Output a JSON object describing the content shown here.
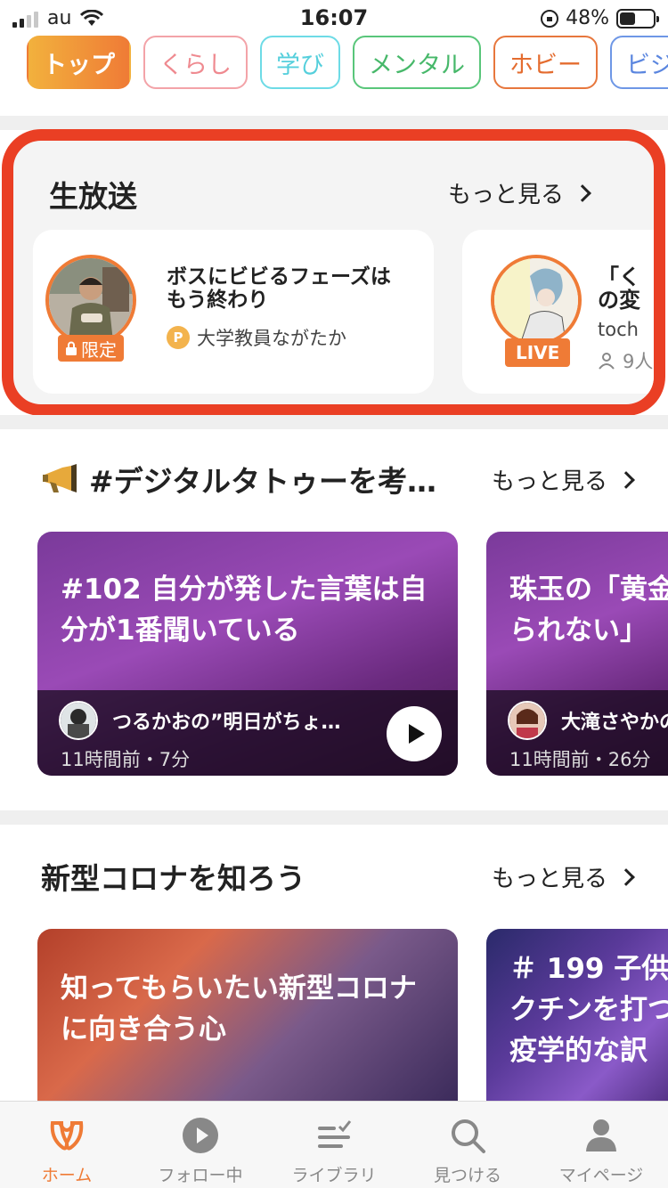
{
  "status_bar": {
    "carrier": "au",
    "time": "16:07",
    "battery_percent": "48%",
    "battery_level": 0.48
  },
  "category_tabs": [
    {
      "label": "トップ",
      "active": true
    },
    {
      "label": "くらし",
      "active": false
    },
    {
      "label": "学び",
      "active": false
    },
    {
      "label": "メンタル",
      "active": false
    },
    {
      "label": "ホビー",
      "active": false
    },
    {
      "label": "ビジ",
      "active": false
    }
  ],
  "live_section": {
    "title": "生放送",
    "more_label": "もっと見る",
    "cards": [
      {
        "title_line1": "ボスにビビるフェーズは",
        "title_line2": "もう終わり",
        "badge": "限定",
        "host": "大学教員ながたか",
        "coin_icon": "P"
      },
      {
        "title_line1": "「く",
        "title_line2": "の変",
        "badge": "LIVE",
        "host": "toch",
        "listeners": "9人"
      }
    ]
  },
  "digital_section": {
    "title": "#デジタルタトゥーを考…",
    "more_label": "もっと見る",
    "cards": [
      {
        "title_line1": "#102 自分が発した言葉は自",
        "title_line2": "分が1番聞いている",
        "author": "つるかおの”明日がちょ…",
        "meta": "11時間前・7分"
      },
      {
        "title_line1": "珠玉の「黄金",
        "title_line2": "られない」",
        "author": "大滝さやかの",
        "meta": "11時間前・26分"
      }
    ]
  },
  "corona_section": {
    "title": "新型コロナを知ろう",
    "more_label": "もっと見る",
    "cards": [
      {
        "title_line1": "知ってもらいたい新型コロナ",
        "title_line2": "に向き合う心"
      },
      {
        "title_line1": "＃ 199 子供",
        "title_line2": "クチンを打つ",
        "title_line3": "疫学的な訳"
      }
    ]
  },
  "tab_bar": [
    {
      "label": "ホーム",
      "icon": "home-icon",
      "active": true
    },
    {
      "label": "フォロー中",
      "icon": "play-circle-icon",
      "active": false
    },
    {
      "label": "ライブラリ",
      "icon": "library-icon",
      "active": false
    },
    {
      "label": "見つける",
      "icon": "search-icon",
      "active": false
    },
    {
      "label": "マイページ",
      "icon": "person-icon",
      "active": false
    }
  ],
  "colors": {
    "accent": "#ef7b36",
    "highlight_border": "#ea3f24"
  }
}
